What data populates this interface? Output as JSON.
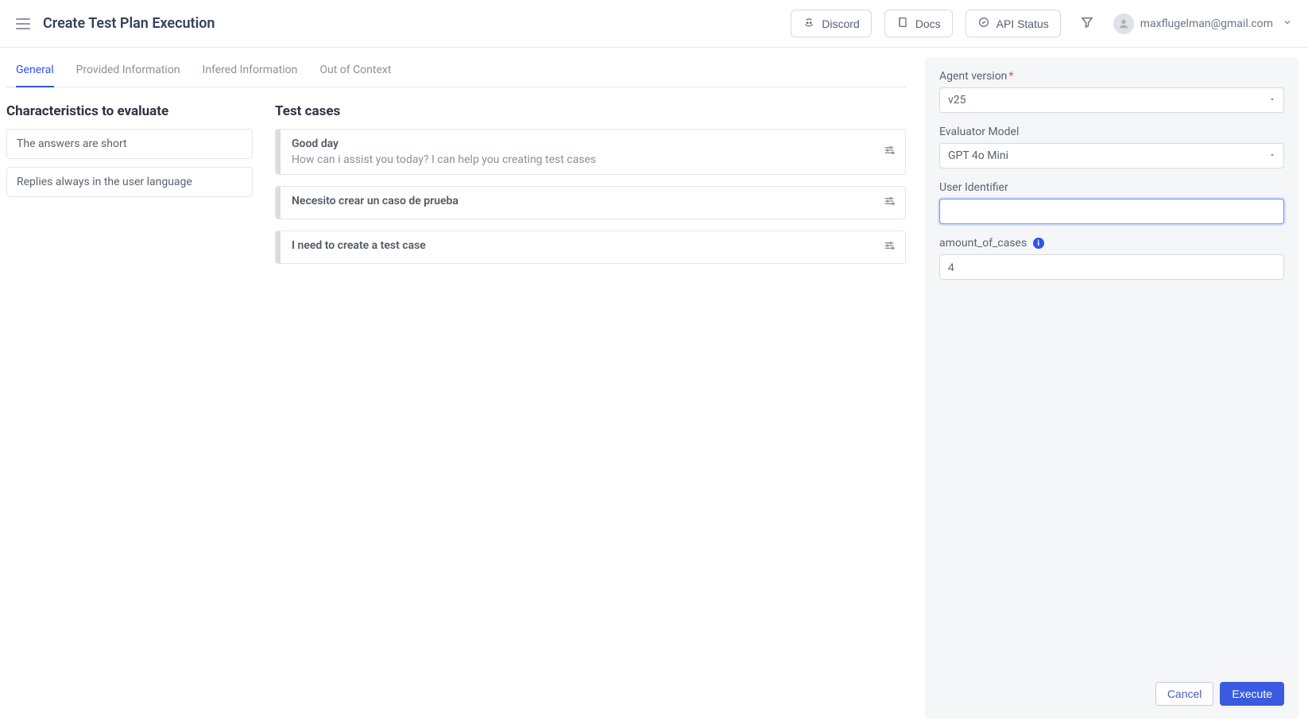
{
  "header": {
    "title": "Create Test Plan Execution",
    "discord_label": "Discord",
    "docs_label": "Docs",
    "api_status_label": "API Status",
    "user_email": "maxflugelman@gmail.com"
  },
  "tabs": [
    {
      "label": "General",
      "active": true
    },
    {
      "label": "Provided Information",
      "active": false
    },
    {
      "label": "Infered Information",
      "active": false
    },
    {
      "label": "Out of Context",
      "active": false
    }
  ],
  "characteristics": {
    "heading": "Characteristics to evaluate",
    "items": [
      {
        "text": "The answers are short"
      },
      {
        "text": "Replies always in the user language"
      }
    ]
  },
  "test_cases": {
    "heading": "Test cases",
    "items": [
      {
        "title": "Good day",
        "subtitle": "How can i assist you today? I can help you creating test cases"
      },
      {
        "title": "Necesito crear un caso de prueba",
        "subtitle": ""
      },
      {
        "title": "I need to create a test case",
        "subtitle": ""
      }
    ]
  },
  "panel": {
    "agent_version_label": "Agent version",
    "agent_version_value": "v25",
    "evaluator_model_label": "Evaluator Model",
    "evaluator_model_value": "GPT 4o Mini",
    "user_identifier_label": "User Identifier",
    "user_identifier_value": "",
    "amount_of_cases_label": "amount_of_cases",
    "amount_of_cases_value": "4",
    "cancel_label": "Cancel",
    "execute_label": "Execute"
  }
}
